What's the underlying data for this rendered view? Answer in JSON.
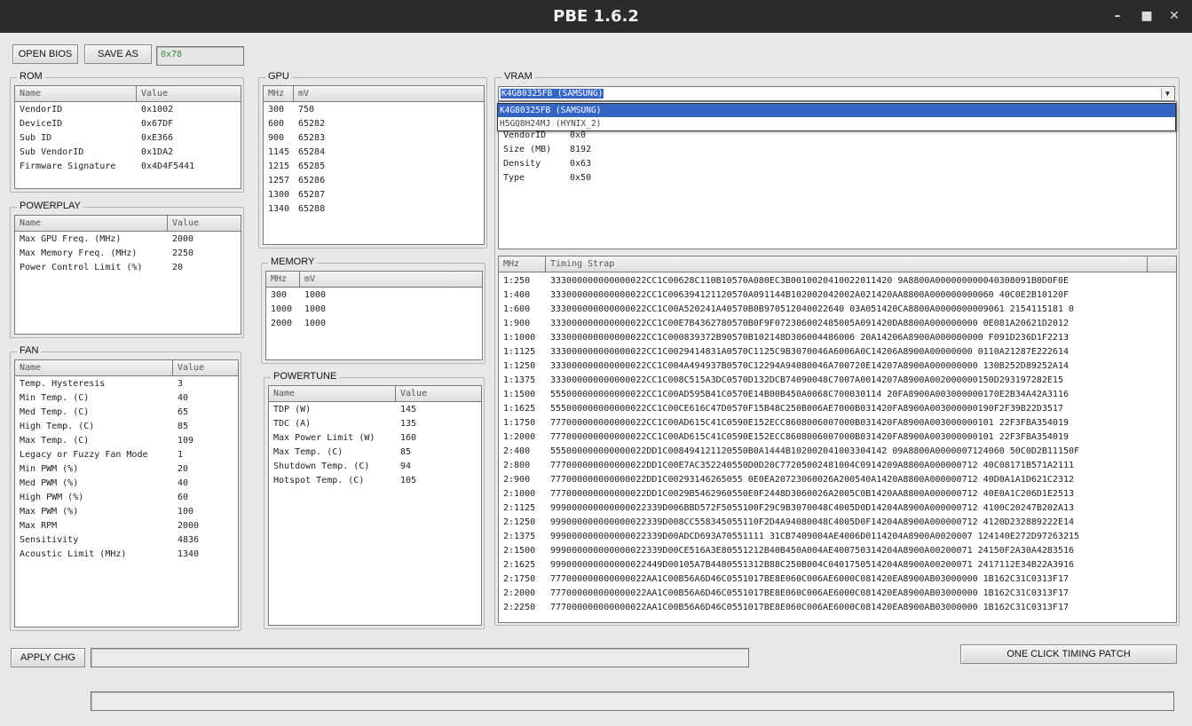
{
  "window": {
    "title": "PBE 1.6.2"
  },
  "toolbar": {
    "open_label": "OPEN BIOS",
    "save_label": "SAVE AS",
    "hex_value": "0x78"
  },
  "rom": {
    "title": "ROM",
    "headers": [
      "Name",
      "Value"
    ],
    "rows": [
      [
        "VendorID",
        "0x1002"
      ],
      [
        "DeviceID",
        "0x67DF"
      ],
      [
        "Sub ID",
        "0xE366"
      ],
      [
        "Sub VendorID",
        "0x1DA2"
      ],
      [
        "Firmware Signature",
        "0x4D4F5441"
      ]
    ]
  },
  "powerplay": {
    "title": "POWERPLAY",
    "headers": [
      "Name",
      "Value"
    ],
    "rows": [
      [
        "Max GPU Freq. (MHz)",
        "2000"
      ],
      [
        "Max Memory Freq. (MHz)",
        "2250"
      ],
      [
        "Power Control Limit (%)",
        "20"
      ]
    ]
  },
  "fan": {
    "title": "FAN",
    "headers": [
      "Name",
      "Value"
    ],
    "rows": [
      [
        "Temp. Hysteresis",
        "3"
      ],
      [
        "Min Temp. (C)",
        "40"
      ],
      [
        "Med Temp. (C)",
        "65"
      ],
      [
        "High Temp. (C)",
        "85"
      ],
      [
        "Max Temp. (C)",
        "109"
      ],
      [
        "Legacy or Fuzzy Fan Mode",
        "1"
      ],
      [
        "Min PWM (%)",
        "20"
      ],
      [
        "Med PWM (%)",
        "40"
      ],
      [
        "High PWM (%)",
        "60"
      ],
      [
        "Max PWM (%)",
        "100"
      ],
      [
        "Max RPM",
        "2000"
      ],
      [
        "Sensitivity",
        "4836"
      ],
      [
        "Acoustic Limit (MHz)",
        "1340"
      ]
    ]
  },
  "gpu": {
    "title": "GPU",
    "headers": [
      "MHz",
      "mV"
    ],
    "rows": [
      [
        "300",
        "750"
      ],
      [
        "600",
        "65282"
      ],
      [
        "900",
        "65283"
      ],
      [
        "1145",
        "65284"
      ],
      [
        "1215",
        "65285"
      ],
      [
        "1257",
        "65286"
      ],
      [
        "1300",
        "65287"
      ],
      [
        "1340",
        "65288"
      ]
    ]
  },
  "memory": {
    "title": "MEMORY",
    "headers": [
      "MHz",
      "mV"
    ],
    "rows": [
      [
        "300",
        "1000"
      ],
      [
        "1000",
        "1000"
      ],
      [
        "2000",
        "1000"
      ]
    ]
  },
  "powertune": {
    "title": "POWERTUNE",
    "headers": [
      "Name",
      "Value"
    ],
    "rows": [
      [
        "TDP (W)",
        "145"
      ],
      [
        "TDC (A)",
        "135"
      ],
      [
        "Max Power Limit (W)",
        "160"
      ],
      [
        "Max Temp. (C)",
        "85"
      ],
      [
        "Shutdown Temp. (C)",
        "94"
      ],
      [
        "Hotspot Temp. (C)",
        "105"
      ]
    ]
  },
  "vram": {
    "title": "VRAM",
    "selected": "K4G80325FB (SAMSUNG)",
    "options": [
      "K4G80325FB (SAMSUNG)",
      "H5GQ8H24MJ (HYNIX_2)"
    ],
    "info": [
      [
        "VendorID",
        "0x0"
      ],
      [
        "Size (MB)",
        "8192"
      ],
      [
        "Density",
        "0x63"
      ],
      [
        "Type",
        "0x50"
      ]
    ]
  },
  "timings": {
    "headers": [
      "MHz",
      "Timing Strap"
    ],
    "rows": [
      [
        "1:250",
        "333000000000000022CC1C00628C110B10570A080EC3B0010020410022011420 9A8800A000000000040308091B0D0F0E"
      ],
      [
        "1:400",
        "333000000000000022CC1C006394121120570A091144B102002042002A021420AA8800A000000000060 40C0E2B10120F"
      ],
      [
        "1:600",
        "333000000000000022CC1C00A520241A40570B0B970512040022640 03A051420CA8800A0000000009061 2154115181 0"
      ],
      [
        "1:900",
        "333000000000000022CC1C00E7B4362780570B0F9F072306002485005A091420DA8800A000000000 0E081A20621D2012"
      ],
      [
        "1:1000",
        "333000000000000022CC1C000839372B90570B102148D306004486006 20A14206A8900A000000000 F091D236D1F2213"
      ],
      [
        "1:1125",
        "333000000000000022CC1C0029414831A0570C1125C9B3070046A6006A0C14206A8900A00000000 0110A21287E222614"
      ],
      [
        "1:1250",
        "333000000000000022CC1C004A494937B0570C12294A94080046A700720E14207A8900A000000000 130B252D89252A14"
      ],
      [
        "1:1375",
        "333000000000000022CC1C008C515A3DC0570D132DCB74090048C7007A0014207A8900A002000000150D293197282E15"
      ],
      [
        "1:1500",
        "555000000000000022CC1C00AD595B41C0570E14B00B450A0068C700030114 20FA8900A003000000170E2B34A42A3116"
      ],
      [
        "1:1625",
        "555000000000000022CC1C00CE616C47D0570F15B48C250B006AE7000B031420FA8900A003000000190F2F39B22D3517"
      ],
      [
        "1:1750",
        "777000000000000022CC1C00AD615C41C0590E152ECC8608006007000B031420FA8900A003000000101 22F3FBA354019"
      ],
      [
        "1:2000",
        "777000000000000022CC1C00AD615C41C0590E152ECC8608006007000B031420FA8900A003000000101 22F3FBA354019"
      ],
      [
        "2:400",
        "555000000000000022DD1C008494121120550B0A1444B102002041003304142 09A8800A0000007124060 50C0D2B11150F"
      ],
      [
        "2:800",
        "777000000000000022DD1C00E7AC352240550D0D20C77205002481004C0914209A8800A000000712 40C08171B571A2111"
      ],
      [
        "2:900",
        "777000000000000022DD1C00293146265055 0E0EA20723060026A200540A1420A8800A000000712 40D0A1A1D621C2312"
      ],
      [
        "2:1000",
        "777000000000000022DD1C0029B5462960550E0F2448D3060026A2005C0B1420AA8800A000000712 40E0A1C206D1E2513"
      ],
      [
        "2:1125",
        "999000000000000022339D006BBD572F5055100F29C9B3070048C4005D0D14204A8900A000000712 4100C20247B202A13"
      ],
      [
        "2:1250",
        "999000000000000022339D008CC558345055110F2D4A94080048C4005D0F14204A8900A000000712 4120D232889222E14"
      ],
      [
        "2:1375",
        "999000000000000022339D00ADCD693A70551111 31CB7409004AE4006D0114204A8900A0020007 124140E272D97263215"
      ],
      [
        "2:1500",
        "999000000000000022339D00CE516A3E80551212B40B450A004AE400750314204A8900A00200071 24150F2A30A4283516"
      ],
      [
        "2:1625",
        "999000000000000022449D00105A7B4480551312B88C250B004C0401750514204A8900A00200071 2417112E34B22A3916"
      ],
      [
        "2:1750",
        "777000000000000022AA1C00B56A6D46C0551017BE8E060C006AE6000C081420EA8900AB03000000 1B162C31C0313F17"
      ],
      [
        "2:2000",
        "777000000000000022AA1C00B56A6D46C0551017BE8E060C006AE6000C081420EA8900AB03000000 1B162C31C0313F17"
      ],
      [
        "2:2250",
        "777000000000000022AA1C00B56A6D46C0551017BE8E060C006AE6000C081420EA8900AB03000000 1B162C31C0313F17"
      ]
    ]
  },
  "footer": {
    "apply_label": "APPLY CHG",
    "patch_label": "ONE CLICK TIMING PATCH"
  }
}
